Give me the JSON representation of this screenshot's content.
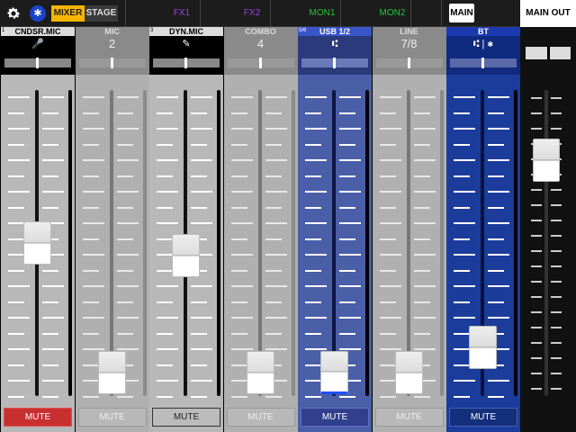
{
  "topbar": {
    "mixer_label": "MIXER",
    "stage_label": "STAGE",
    "sends": [
      "FX1",
      "FX2",
      "MON1",
      "MON2"
    ],
    "main_label": "MAIN"
  },
  "colors": {
    "mixer_accent": "#f7b500",
    "fx_color": "#a040e0",
    "mon_color": "#27c23a",
    "usb_channel": "#4a5fa8",
    "bt_channel": "#1c3c9c",
    "mute_active": "#c83030"
  },
  "channels": [
    {
      "num": "1",
      "name": "CNDSR.MIC",
      "icon": "microphone-icon",
      "active": true,
      "color": "gray",
      "fader_level": 0.5,
      "mute": "MUTE",
      "mute_on": true
    },
    {
      "num": "",
      "name": "MIC",
      "icon": "",
      "sub": "2",
      "active": false,
      "color": "gray",
      "fader_level": 0.07,
      "mute": "MUTE",
      "mute_on": false
    },
    {
      "num": "3",
      "name": "DYN.MIC",
      "icon": "dynamic-mic-icon",
      "active": true,
      "color": "gray",
      "fader_level": 0.46,
      "mute": "MUTE",
      "mute_on": false
    },
    {
      "num": "",
      "name": "COMBO",
      "icon": "",
      "sub": "4",
      "active": false,
      "color": "gray",
      "fader_level": 0.07,
      "mute": "MUTE",
      "mute_on": false
    },
    {
      "num": "5/6",
      "name": "USB 1/2",
      "icon": "usb-icon",
      "active": true,
      "color": "usb",
      "fader_level": 0.07,
      "mute": "MUTE",
      "mute_on": false
    },
    {
      "num": "",
      "name": "LINE",
      "icon": "",
      "sub": "7/8",
      "active": false,
      "color": "gray",
      "fader_level": 0.07,
      "mute": "MUTE",
      "mute_on": false
    },
    {
      "num": "",
      "name": "BT",
      "icon": "usb-bluetooth-icon",
      "active": true,
      "color": "bt",
      "fader_level": 0.16,
      "mute": "MUTE",
      "mute_on": false
    }
  ],
  "main_out": {
    "label": "MAIN OUT",
    "fader_level": 0.77
  }
}
